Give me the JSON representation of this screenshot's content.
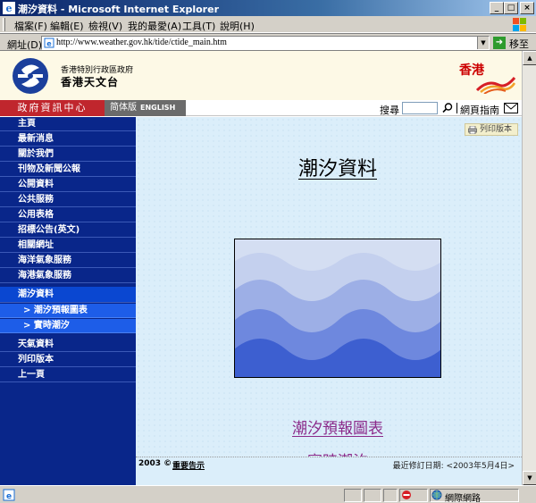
{
  "window": {
    "title": "潮汐資料 - Microsoft Internet Explorer"
  },
  "menu": {
    "items": [
      "檔案(F)",
      "編輯(E)",
      "檢視(V)",
      "我的最愛(A)",
      "工具(T)",
      "說明(H)"
    ]
  },
  "address": {
    "label": "網址(D)",
    "url": "http://www.weather.gov.hk/tide/ctide_main.htm",
    "go_label": "移至"
  },
  "banner": {
    "org_line1": "香港特別行政區政府",
    "org_line2": "香港天文台",
    "hk_label": "香港"
  },
  "topnav": {
    "gov_label": "政府資訊中心",
    "simplified_label": "简体版",
    "english_label": "ENGLISH",
    "search_label": "搜尋",
    "search_value": "",
    "site_guide_label": "網頁指南"
  },
  "sidebar": {
    "items": [
      "主頁",
      "最新消息",
      "關於我們",
      "刊物及新聞公報",
      "公開資料",
      "公共服務",
      "公用表格",
      "招標公告(英文)",
      "相關網址",
      "海洋氣象服務",
      "海港氣象服務"
    ],
    "active": "潮汐資料",
    "subitems": [
      "> 潮汐預報圖表",
      "> 實時潮汐"
    ],
    "items_after": [
      "天氣資料",
      "列印版本",
      "上一頁"
    ]
  },
  "main": {
    "print_label": "列印版本",
    "title": "潮汐資料",
    "link_forecast": "潮汐預報圖表",
    "link_realtime": "實時潮汐"
  },
  "footer": {
    "copyright": "2003 ©",
    "notice": "重要告示",
    "last_updated": "最近修訂日期: <2003年5月4日>"
  },
  "status": {
    "zone": "網際網路"
  },
  "colors": {
    "sidebar_bg": "#09268a",
    "sidebar_active": "#0a47d1",
    "gov_red": "#c0262d",
    "link_purple": "#8b2a8a",
    "content_bg": "#dbeefa"
  }
}
